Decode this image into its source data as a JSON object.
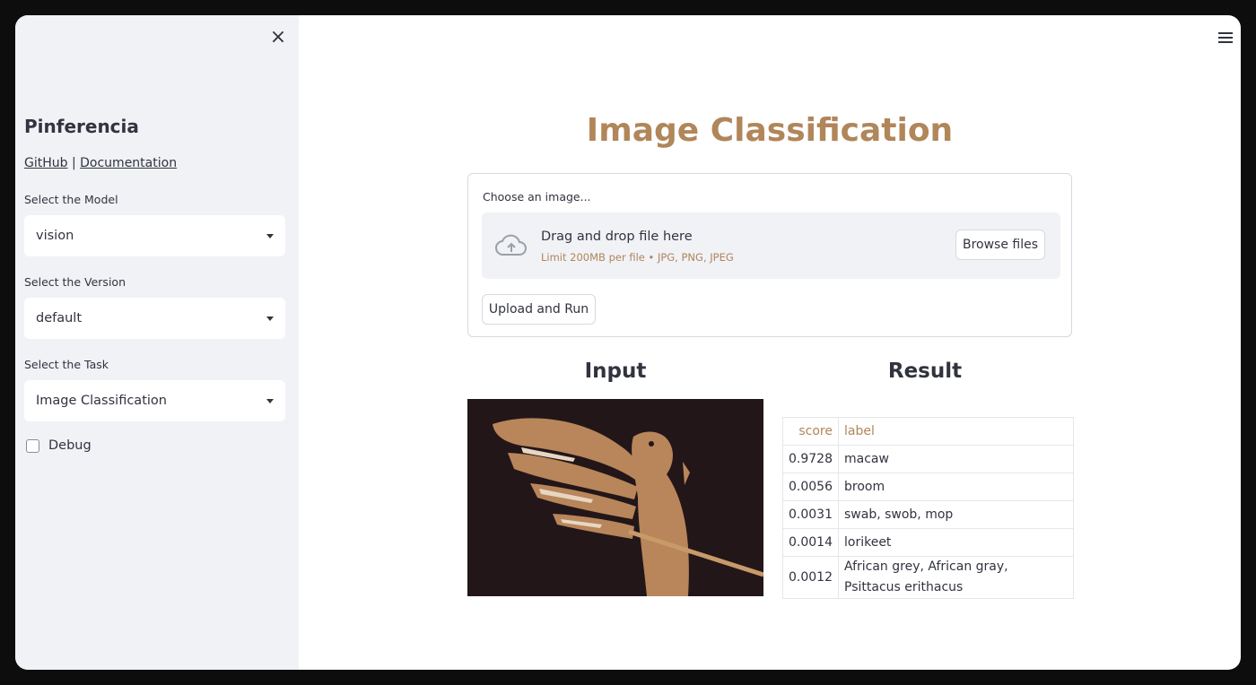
{
  "sidebar": {
    "close_symbol": "×",
    "app_title": "Pinferencia",
    "links": {
      "github": "GitHub",
      "separator": "|",
      "docs": "Documentation"
    },
    "model": {
      "label": "Select the Model",
      "value": "vision"
    },
    "version": {
      "label": "Select the Version",
      "value": "default"
    },
    "task": {
      "label": "Select the Task",
      "value": "Image Classification"
    },
    "debug": {
      "label": "Debug",
      "checked": false
    }
  },
  "main": {
    "title": "Image Classification",
    "uploader": {
      "label": "Choose an image...",
      "drop_text": "Drag and drop file here",
      "limit_text": "Limit 200MB per file • JPG, PNG, JPEG",
      "browse_label": "Browse files"
    },
    "run_label": "Upload and Run",
    "input_heading": "Input",
    "result_heading": "Result",
    "result_table": {
      "headers": {
        "score": "score",
        "label": "label"
      },
      "rows": [
        {
          "score": "0.9728",
          "label": "macaw"
        },
        {
          "score": "0.0056",
          "label": "broom"
        },
        {
          "score": "0.0031",
          "label": "swab, swob, mop"
        },
        {
          "score": "0.0014",
          "label": "lorikeet"
        },
        {
          "score": "0.0012",
          "label": "African grey, African gray, Psittacus erithacus"
        }
      ]
    }
  },
  "colors": {
    "accent": "#b0865a",
    "text": "#31333f",
    "sidebar_bg": "#f0f2f6"
  },
  "icons": [
    "close-icon",
    "hamburger-menu-icon",
    "cloud-upload-icon",
    "caret-down-icon"
  ]
}
